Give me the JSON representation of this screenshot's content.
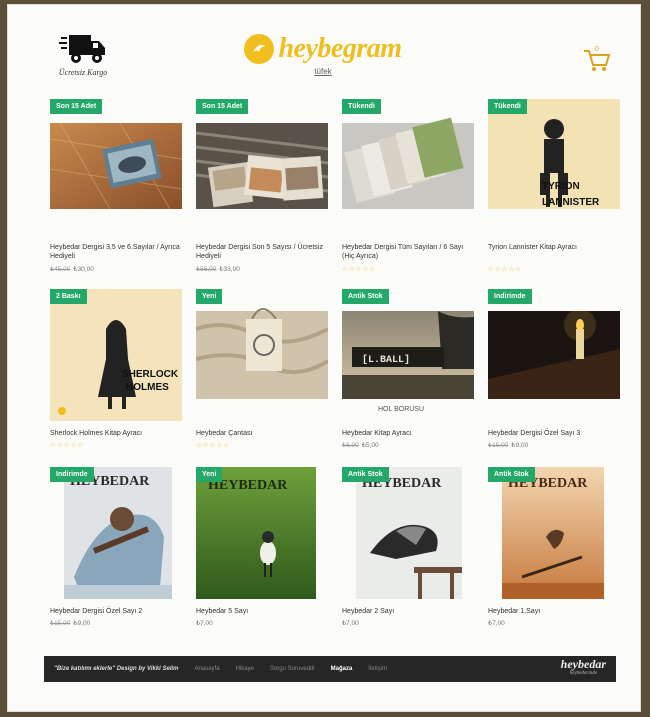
{
  "header": {
    "shipping_label": "Ücretsiz Kargo",
    "logo_text": "heybegram",
    "logo_sub": "tüfek",
    "cart_count": "0"
  },
  "products": [
    {
      "badge": "Son 15 Adet",
      "title": "Heybedar Dergisi 3,5 ve 6.Sayılar / Ayrıca Hediyeli",
      "old_price": "₺45,00",
      "price": "₺30,00"
    },
    {
      "badge": "Son 15 Adet",
      "title": "Heybedar Dergisi Son 5 Sayısı / Ücretsiz Hediyeli",
      "old_price": "₺56,00",
      "price": "₺33,00"
    },
    {
      "badge": "Tükendi",
      "title": "Heybedar Dergisi Tüm Sayıları / 6 Sayı (Hiç Ayrıca)",
      "old_price": "",
      "price": "",
      "stars": "☆☆☆☆☆"
    },
    {
      "badge": "Tükendi",
      "title": "Tyrion Lannister Kitap Ayracı",
      "old_price": "",
      "price": "",
      "stars": "☆☆☆☆☆"
    },
    {
      "badge": "2 Baskı",
      "title": "Sherlock Holmes Kitap Ayracı",
      "old_price": "",
      "price": "",
      "stars": "☆☆☆☆☆"
    },
    {
      "badge": "Yeni",
      "title": "Heybedar Çantası",
      "old_price": "",
      "price": "",
      "stars": "☆☆☆☆☆"
    },
    {
      "badge": "Antik Stok",
      "title": "Heybedar Kitap Ayracı",
      "old_price": "₺6,00",
      "price": "₺5,00"
    },
    {
      "badge": "Indirimde",
      "title": "Heybedar Dergisi Özel Sayı 3",
      "old_price": "₺15,00",
      "price": "₺9,00"
    },
    {
      "badge": "Indirimde",
      "title": "Heybedar Dergisi Özel Sayı 2",
      "old_price": "₺15,00",
      "price": "₺9,00"
    },
    {
      "badge": "Yeni",
      "title": "Heybedar 5 Sayı",
      "old_price": "",
      "price": "₺7,00"
    },
    {
      "badge": "Antik Stok",
      "title": "Heybedar 2 Sayı",
      "old_price": "",
      "price": "₺7,00"
    },
    {
      "badge": "Antik Stok",
      "title": "Heybedar 1.Sayı",
      "old_price": "",
      "price": "₺7,00"
    }
  ],
  "image_texts": {
    "tyrion_name": "TYRION",
    "tyrion_surname": "LANNISTER",
    "sherlock_name": "SHERLOCK",
    "sherlock_surname": "HOLMES",
    "sign_text": "[L.BALL]",
    "sign_caption": "HOL BORUSU",
    "magazine_title": "HEYBEDAR"
  },
  "footer": {
    "credit": "\"Bize katılımı eklerle\" Design by Vikki Selim",
    "links": [
      "Anasayfa",
      "Hikaye",
      "Sorgu Soruveddi",
      "Mağaza",
      "İletişim"
    ],
    "logo": "heybedar",
    "logo_sub": "heybedarinde"
  },
  "colors": {
    "accent": "#f0bf1f",
    "badge": "#24a86a",
    "footer_bg": "#262626"
  },
  "icons": {
    "shipping": "truck-icon",
    "cart": "cart-icon",
    "logo": "logo-circle-icon"
  }
}
